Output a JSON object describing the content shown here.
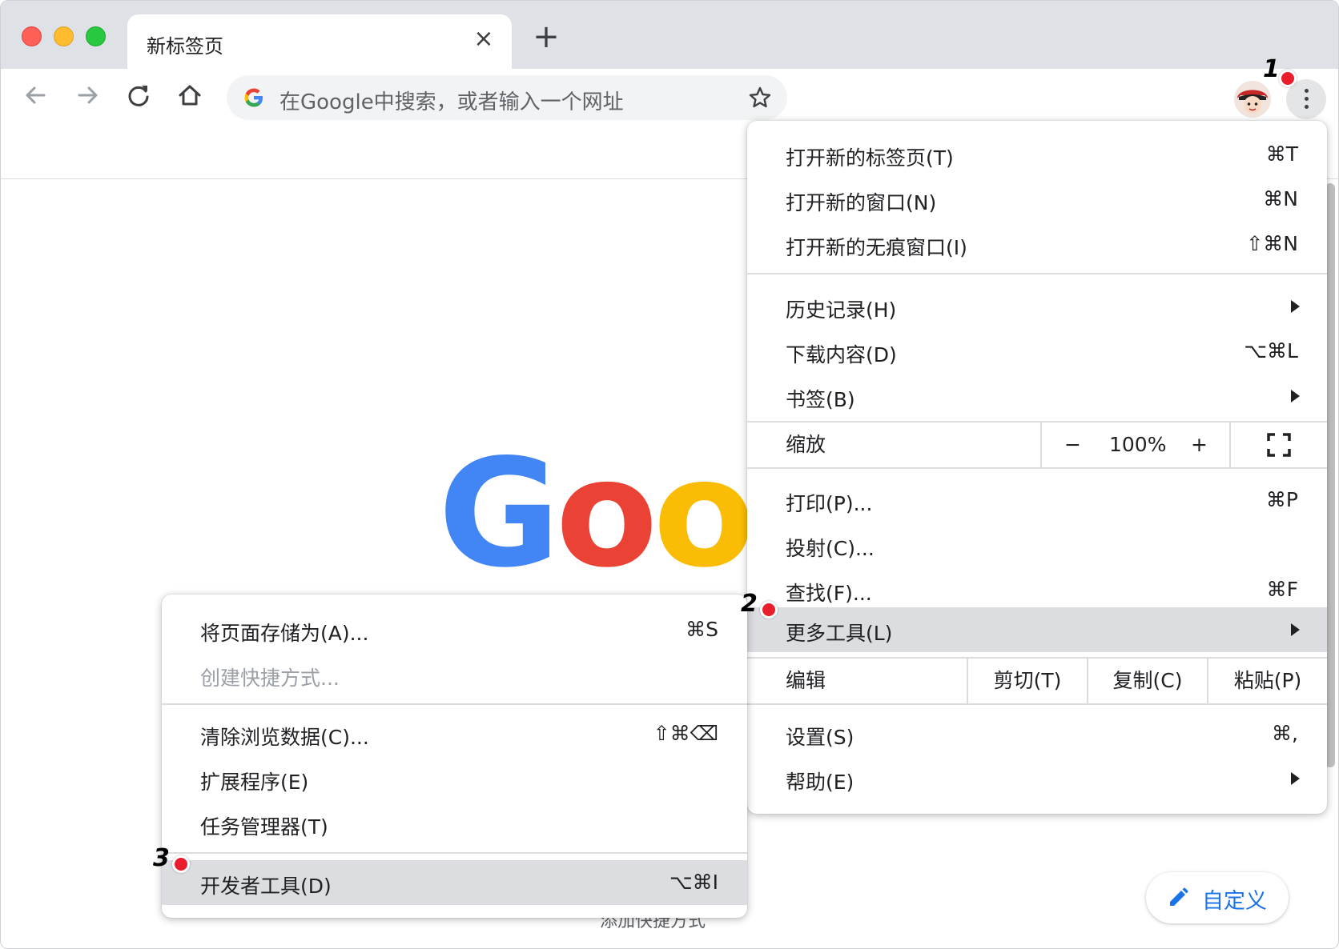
{
  "tab": {
    "title": "新标签页"
  },
  "omnibox": {
    "placeholder": "在Google中搜索，或者输入一个网址"
  },
  "page": {
    "customize_label": "自定义",
    "add_shortcut_label": "添加快捷方式"
  },
  "colors": {
    "accent": "#1a73e8",
    "highlight": "#dcdde0",
    "marker": "#ea1d2c"
  },
  "icons": [
    "back-icon",
    "forward-icon",
    "reload-icon",
    "home-icon",
    "google-g-icon",
    "star-icon",
    "avatar-icon",
    "more-vert-icon",
    "pencil-icon",
    "fullscreen-icon"
  ],
  "annotations": [
    "1",
    "2",
    "3"
  ],
  "main_menu": {
    "items_top": [
      {
        "label": "打开新的标签页(T)",
        "shortcut": "⌘T"
      },
      {
        "label": "打开新的窗口(N)",
        "shortcut": "⌘N"
      },
      {
        "label": "打开新的无痕窗口(I)",
        "shortcut": "⇧⌘N"
      }
    ],
    "items_mid": [
      {
        "label": "历史记录(H)",
        "shortcut": ""
      },
      {
        "label": "下载内容(D)",
        "shortcut": "⌥⌘L"
      },
      {
        "label": "书签(B)",
        "shortcut": ""
      }
    ],
    "zoom": {
      "label": "缩放",
      "minus": "−",
      "value": "100%",
      "plus": "+"
    },
    "items_tools": [
      {
        "label": "打印(P)...",
        "shortcut": "⌘P"
      },
      {
        "label": "投射(C)...",
        "shortcut": ""
      },
      {
        "label": "查找(F)...",
        "shortcut": "⌘F"
      },
      {
        "label": "更多工具(L)",
        "shortcut": ""
      }
    ],
    "edit": {
      "label": "编辑",
      "cut": "剪切(T)",
      "copy": "复制(C)",
      "paste": "粘贴(P)"
    },
    "items_bottom": [
      {
        "label": "设置(S)",
        "shortcut": "⌘,"
      },
      {
        "label": "帮助(E)",
        "shortcut": ""
      }
    ]
  },
  "sub_menu": {
    "items_a": [
      {
        "label": "将页面存储为(A)...",
        "shortcut": "⌘S"
      },
      {
        "label": "创建快捷方式...",
        "shortcut": ""
      }
    ],
    "items_b": [
      {
        "label": "清除浏览数据(C)...",
        "shortcut": "⇧⌘⌫"
      },
      {
        "label": "扩展程序(E)",
        "shortcut": ""
      },
      {
        "label": "任务管理器(T)",
        "shortcut": ""
      }
    ],
    "items_c": [
      {
        "label": "开发者工具(D)",
        "shortcut": "⌥⌘I"
      }
    ]
  }
}
